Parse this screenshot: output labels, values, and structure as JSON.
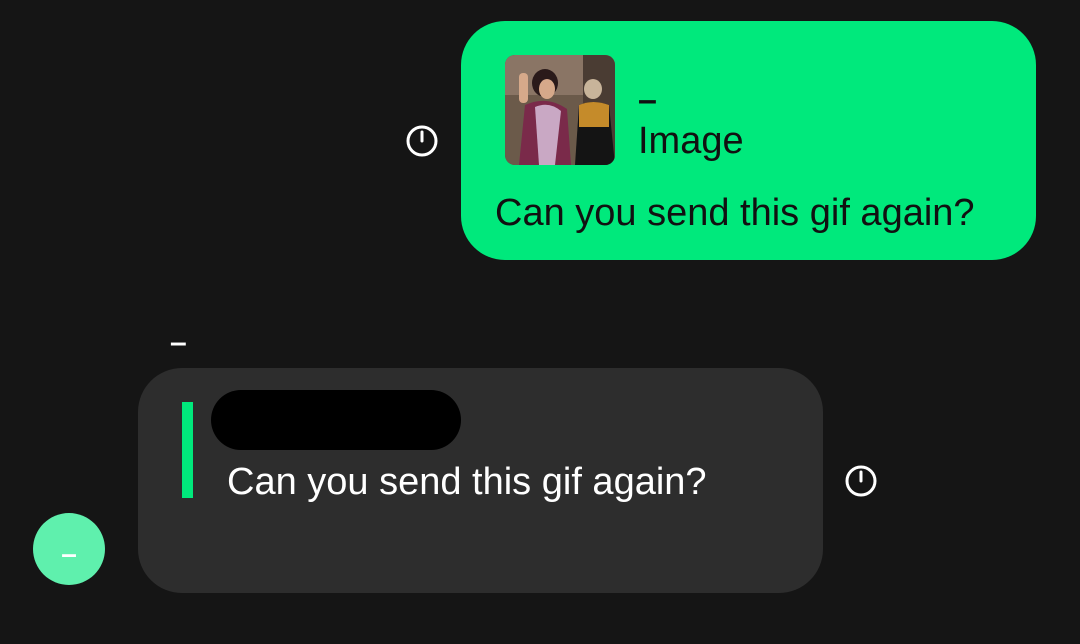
{
  "conversation": {
    "outgoing": {
      "quote": {
        "author": "–",
        "media_type": "Image",
        "thumbnail_icon": "gif-thumbnail-image"
      },
      "text": "Can you send this gif again?",
      "status_icon": "pending-clock-icon"
    },
    "incoming": {
      "sender_name": "–",
      "avatar_initial": "–",
      "quote": {
        "author": "[redacted]",
        "text": "Can you send this gif again?"
      },
      "status_icon": "pending-clock-icon"
    }
  },
  "colors": {
    "background": "#151515",
    "outgoing_bubble": "#00e97c",
    "incoming_bubble": "#2d2d2d",
    "quote_accent": "#00e97c",
    "avatar": "#5ff0ad"
  }
}
